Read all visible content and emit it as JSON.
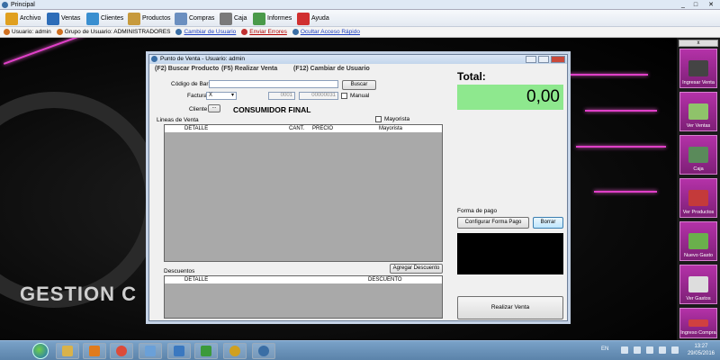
{
  "app": {
    "title": "Principal",
    "win_min": "_",
    "win_max": "□",
    "win_close": "✕"
  },
  "menu": [
    {
      "label": "Archivo",
      "color": "#e0a020"
    },
    {
      "label": "Ventas",
      "color": "#2e6db8"
    },
    {
      "label": "Clientes",
      "color": "#3a8fd0"
    },
    {
      "label": "Productos",
      "color": "#c79a3d"
    },
    {
      "label": "Compras",
      "color": "#6b8fc0"
    },
    {
      "label": "Caja",
      "color": "#7a7a7a"
    },
    {
      "label": "Informes",
      "color": "#4a9a4a"
    },
    {
      "label": "Ayuda",
      "color": "#d03030"
    }
  ],
  "userbar": {
    "user_label": "Usuario: admin",
    "group_label": "Grupo de Usuario: ADMINISTRADORES",
    "change_user": "Cambiar de Usuario",
    "send_errors": "Enviar Errores",
    "hide_quick": "Ocultar Acceso Rápido"
  },
  "background": {
    "brand_text": "GESTION C"
  },
  "dock": {
    "header": "x",
    "items": [
      {
        "label": "Ingresar Venta",
        "color": "#444"
      },
      {
        "label": "Ver Ventas",
        "color": "#8fc36a"
      },
      {
        "label": "Caja",
        "color": "#5a8a5a"
      },
      {
        "label": "Ver Productos",
        "color": "#c43a3a"
      },
      {
        "label": "Nuevo Gasto",
        "color": "#6ab04c"
      },
      {
        "label": "Ver Gastos",
        "color": "#dddddd"
      },
      {
        "label": "Ingreso Compra",
        "color": "#d04040"
      }
    ]
  },
  "pos": {
    "title": "Punto de Venta - Usuario: admin",
    "hotkey_search": "(F2) Buscar Producto",
    "hotkey_sale": "(F5) Realizar Venta",
    "hotkey_user": "(F12) Cambiar de Usuario",
    "barcode_label": "Código de Barra",
    "barcode_value": "",
    "search_button": "Buscar",
    "invoice_label": "Factura",
    "invoice_type": "X",
    "invoice_series": "0001",
    "invoice_number": "00000031",
    "manual_label": "Manual",
    "client_label": "Cliente",
    "client_button": "...",
    "client_name": "CONSUMIDOR FINAL",
    "lines_label": "Lineas de Venta",
    "wholesale_label": "Mayorista",
    "lines_columns": [
      "DETALLE",
      "CANT.",
      "PRECIO",
      "Mayorista"
    ],
    "discounts_label": "Descuentos",
    "add_discount_button": "Agregar Descuento",
    "discount_columns": [
      "DETALLE",
      "DESCUENTO"
    ],
    "total_label": "Total:",
    "total_value": "0,00",
    "payment_label": "Forma de pago",
    "config_payment_button": "Configurar Forma Pago",
    "clear_button": "Borrar",
    "finish_button": "Realizar Venta"
  },
  "taskbar": {
    "apps": [
      "#d9b24a",
      "#e07b1c",
      "#dd4b39",
      "#6aa0d8",
      "#3a78c0",
      "#3b9a3b",
      "#d0a020",
      "#3a6ea5"
    ],
    "lang": "EN",
    "time": "13:27",
    "date": "29/05/2016"
  }
}
